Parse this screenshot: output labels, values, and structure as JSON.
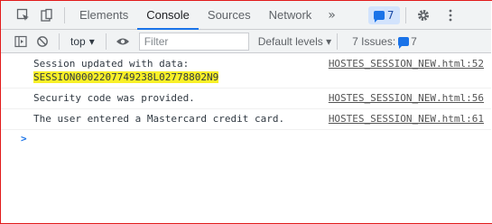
{
  "tabs": [
    "Elements",
    "Console",
    "Sources",
    "Network"
  ],
  "active_tab": "Console",
  "more_tabs_label": "»",
  "messages_badge": "7",
  "toolbar": {
    "context": "top",
    "filter_placeholder": "Filter",
    "levels": "Default levels",
    "issues_label": "7 Issues:",
    "issues_count": "7"
  },
  "console": [
    {
      "text": "Session updated with data:",
      "text2": "SESSION0002207749238L02778802N9",
      "source": "HOSTES_SESSION_NEW.html:52"
    },
    {
      "text": "Security code was provided.",
      "source": "HOSTES_SESSION_NEW.html:56"
    },
    {
      "text": "The user entered a Mastercard credit card.",
      "source": "HOSTES_SESSION_NEW.html:61"
    }
  ],
  "prompt": ">",
  "colors": {
    "accent": "#1a73e8",
    "highlight": "#f9f028",
    "frame": "#e21b1b"
  }
}
